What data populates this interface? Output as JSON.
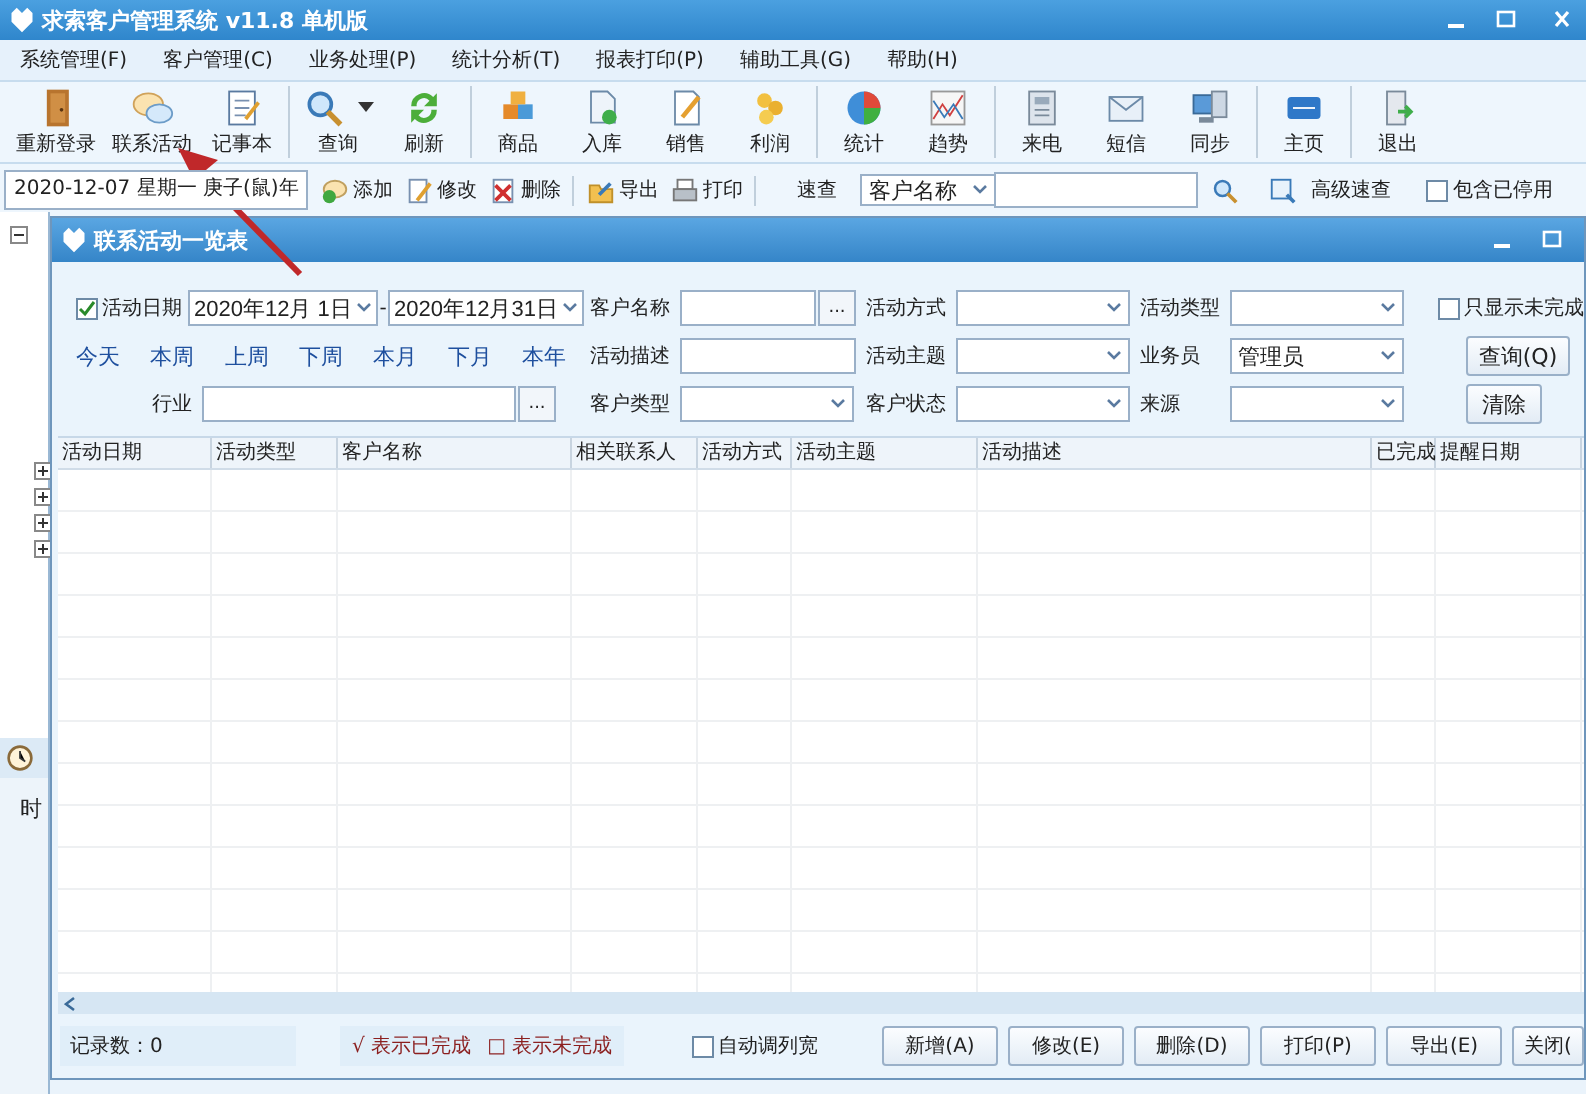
{
  "window": {
    "title": "求索客户管理系统 v11.8 单机版"
  },
  "menu": [
    "系统管理(F)",
    "客户管理(C)",
    "业务处理(P)",
    "统计分析(T)",
    "报表打印(P)",
    "辅助工具(G)",
    "帮助(H)"
  ],
  "toolbar": [
    [
      {
        "label": "重新登录",
        "has_menu": false
      },
      {
        "label": "联系活动",
        "has_menu": false
      },
      {
        "label": "记事本",
        "has_menu": false
      }
    ],
    [
      {
        "label": "查询",
        "has_menu": true
      },
      {
        "label": "刷新",
        "has_menu": false
      }
    ],
    [
      {
        "label": "商品",
        "has_menu": false
      },
      {
        "label": "入库",
        "has_menu": false
      },
      {
        "label": "销售",
        "has_menu": false
      },
      {
        "label": "利润",
        "has_menu": false
      }
    ],
    [
      {
        "label": "统计",
        "has_menu": false
      },
      {
        "label": "趋势",
        "has_menu": false
      }
    ],
    [
      {
        "label": "来电",
        "has_menu": false
      },
      {
        "label": "短信",
        "has_menu": false
      },
      {
        "label": "同步",
        "has_menu": false
      }
    ],
    [
      {
        "label": "主页",
        "has_menu": false
      }
    ],
    [
      {
        "label": "退出",
        "has_menu": false
      }
    ]
  ],
  "quickbar": {
    "date": "2020-12-07 星期一 庚子(鼠)年",
    "actions": [
      [
        {
          "label": "添加"
        },
        {
          "label": "修改"
        },
        {
          "label": "删除"
        }
      ],
      [
        {
          "label": "导出"
        },
        {
          "label": "打印"
        }
      ]
    ],
    "search_label": "速查",
    "search_field": "客户名称",
    "advanced": "高级速查",
    "include_disabled": {
      "label": "包含已停用",
      "checked": false
    }
  },
  "sidebar": {
    "label": "时"
  },
  "child_window": {
    "title": "联系活动一览表",
    "date_enabled": {
      "label": "活动日期",
      "checked": true
    },
    "date_from": "2020年12月 1日",
    "range_separator": "-",
    "date_to": "2020年12月31日",
    "quick_ranges": [
      "今天",
      "本周",
      "上周",
      "下周",
      "本月",
      "下月",
      "本年"
    ],
    "industry": {
      "label": "行业",
      "button": "..."
    },
    "fields": [
      [
        {
          "label": "客户名称",
          "kind": "picker",
          "button": "..."
        },
        {
          "label": "活动方式",
          "kind": "select"
        },
        {
          "label": "活动类型",
          "kind": "select"
        }
      ],
      [
        {
          "label": "活动描述",
          "kind": "input"
        },
        {
          "label": "活动主题",
          "kind": "select"
        },
        {
          "label": "业务员",
          "kind": "select",
          "value": "管理员"
        }
      ],
      [
        {
          "label": "客户类型",
          "kind": "select"
        },
        {
          "label": "客户状态",
          "kind": "select"
        },
        {
          "label": "来源",
          "kind": "select"
        }
      ]
    ],
    "only_incomplete": {
      "label": "只显示未完成",
      "checked": false
    },
    "query_button": "查询(Q)",
    "clear_button": "清除",
    "columns": [
      "活动日期",
      "活动类型",
      "客户名称",
      "相关联系人",
      "活动方式",
      "活动主题",
      "活动描述",
      "已完成",
      "提醒日期"
    ],
    "record_count": "记录数：0",
    "legend": [
      {
        "symbol": "√",
        "text": "表示已完成"
      },
      {
        "symbol": "□",
        "text": "表示未完成"
      }
    ],
    "auto_width": {
      "label": "自动调列宽",
      "checked": false
    },
    "buttons": [
      "新增(A)",
      "修改(E)",
      "删除(D)",
      "打印(P)",
      "导出(E)",
      "关闭("
    ]
  }
}
